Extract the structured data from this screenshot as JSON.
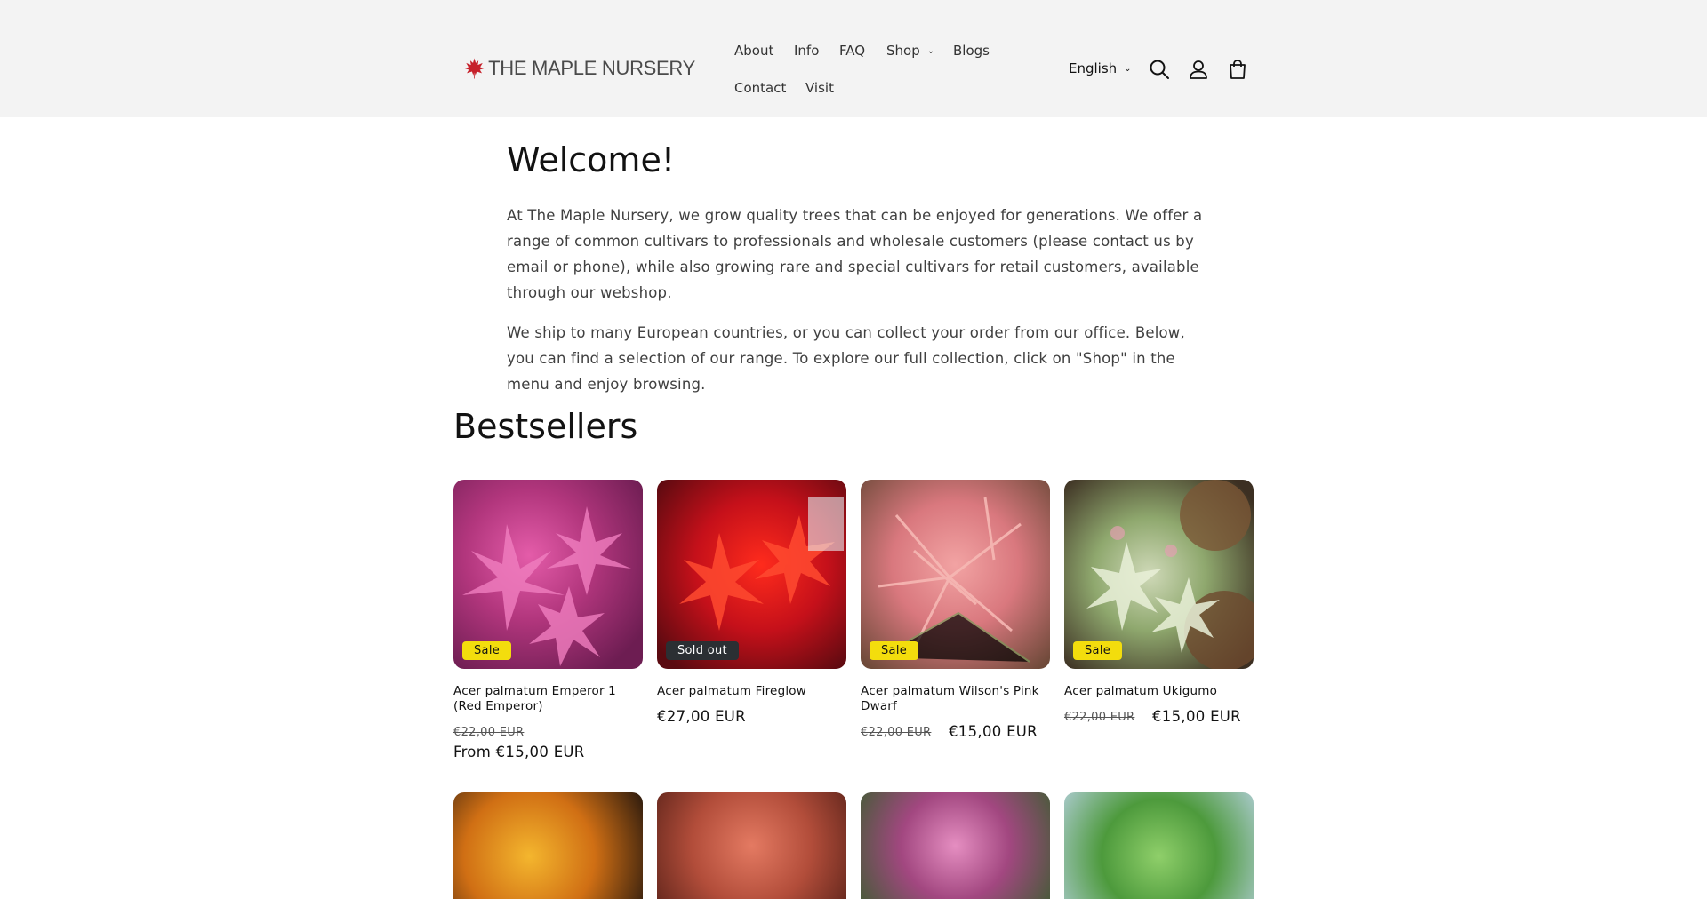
{
  "brand": {
    "name": "THE MAPLE NURSERY",
    "leaf_color": "#c6202a"
  },
  "nav": {
    "about": "About",
    "info": "Info",
    "faq": "FAQ",
    "shop": "Shop",
    "blogs": "Blogs",
    "contact": "Contact",
    "visit": "Visit"
  },
  "header_icons": [
    "search-icon",
    "account-icon",
    "cart-icon"
  ],
  "language": {
    "selected": "English"
  },
  "welcome": {
    "title": "Welcome!",
    "paragraph1": "At The Maple Nursery, we grow quality trees that can be enjoyed for generations. We offer a range of common cultivars to professionals and wholesale customers (please contact us by email or phone), while also growing rare and special cultivars for retail customers, available through our webshop.",
    "paragraph2": "We ship to many European countries, or you can collect your order from our office. Below, you can find a selection of our range. To explore our full collection, click on \"Shop\" in the menu and enjoy browsing."
  },
  "bestsellers": {
    "heading": "Bestsellers",
    "products": [
      {
        "title": "Acer palmatum Emperor 1 (Red Emperor)",
        "badge": "Sale",
        "old_price": "€22,00 EUR",
        "price": "From €15,00 EUR"
      },
      {
        "title": "Acer palmatum Fireglow",
        "badge": "Sold out",
        "price": "€27,00 EUR"
      },
      {
        "title": "Acer palmatum Wilson's Pink Dwarf",
        "badge": "Sale",
        "old_price": "€22,00 EUR",
        "price": "€15,00 EUR"
      },
      {
        "title": "Acer palmatum Ukigumo",
        "badge": "Sale",
        "old_price": "€22,00 EUR",
        "price": "€15,00 EUR"
      }
    ]
  },
  "colors": {
    "header_bg": "#f3f3f3",
    "sale_badge": "#f3dd0d",
    "sold_out_badge": "#2b2f33"
  }
}
